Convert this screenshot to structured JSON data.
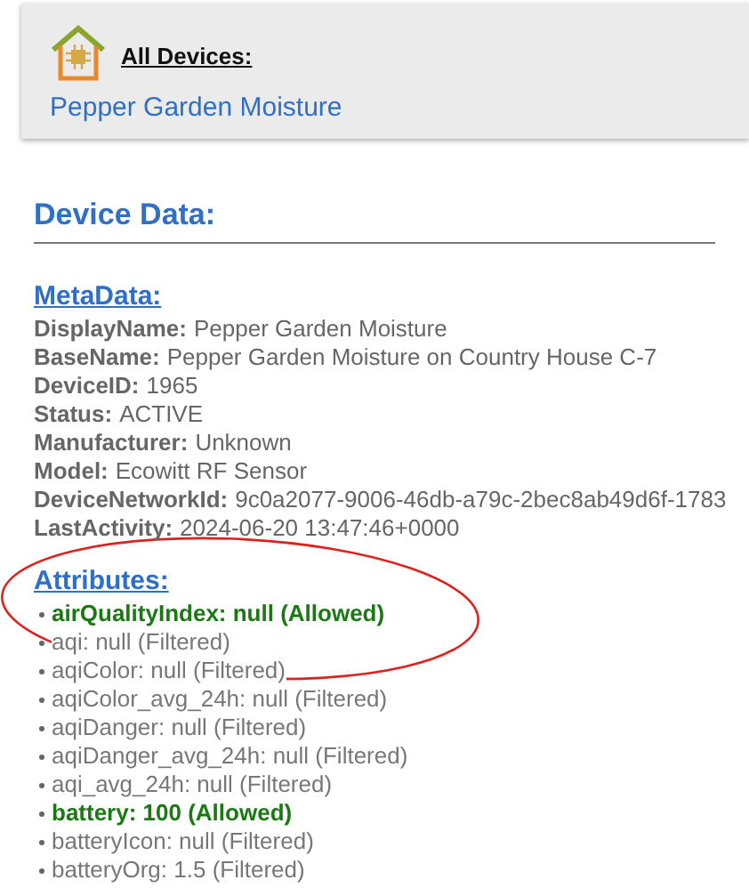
{
  "header": {
    "breadcrumb": "All Devices:",
    "device_name": "Pepper Garden Moisture"
  },
  "device_data": {
    "title": "Device Data:"
  },
  "metadata": {
    "title": "MetaData:",
    "rows": [
      {
        "key": "DisplayName:",
        "value": "Pepper Garden Moisture"
      },
      {
        "key": "BaseName:",
        "value": "Pepper Garden Moisture on Country House C-7"
      },
      {
        "key": "DeviceID:",
        "value": "1965"
      },
      {
        "key": "Status:",
        "value": "ACTIVE"
      },
      {
        "key": "Manufacturer:",
        "value": "Unknown"
      },
      {
        "key": "Model:",
        "value": "Ecowitt RF Sensor"
      },
      {
        "key": "DeviceNetworkId:",
        "value": "9c0a2077-9006-46db-a79c-2bec8ab49d6f-1783"
      },
      {
        "key": "LastActivity:",
        "value": "2024-06-20 13:47:46+0000"
      }
    ]
  },
  "attributes": {
    "title": "Attributes:",
    "items": [
      {
        "text": "airQualityIndex: null (Allowed)",
        "allowed": true
      },
      {
        "text": "aqi: null (Filtered)",
        "allowed": false
      },
      {
        "text": "aqiColor: null (Filtered)",
        "allowed": false
      },
      {
        "text": "aqiColor_avg_24h: null (Filtered)",
        "allowed": false
      },
      {
        "text": "aqiDanger: null (Filtered)",
        "allowed": false
      },
      {
        "text": "aqiDanger_avg_24h: null (Filtered)",
        "allowed": false
      },
      {
        "text": "aqi_avg_24h: null (Filtered)",
        "allowed": false
      },
      {
        "text": "battery: 100 (Allowed)",
        "allowed": true
      },
      {
        "text": "batteryIcon: null (Filtered)",
        "allowed": false
      },
      {
        "text": "batteryOrg: 1.5 (Filtered)",
        "allowed": false
      }
    ]
  },
  "annotation": {
    "kind": "ellipse"
  }
}
